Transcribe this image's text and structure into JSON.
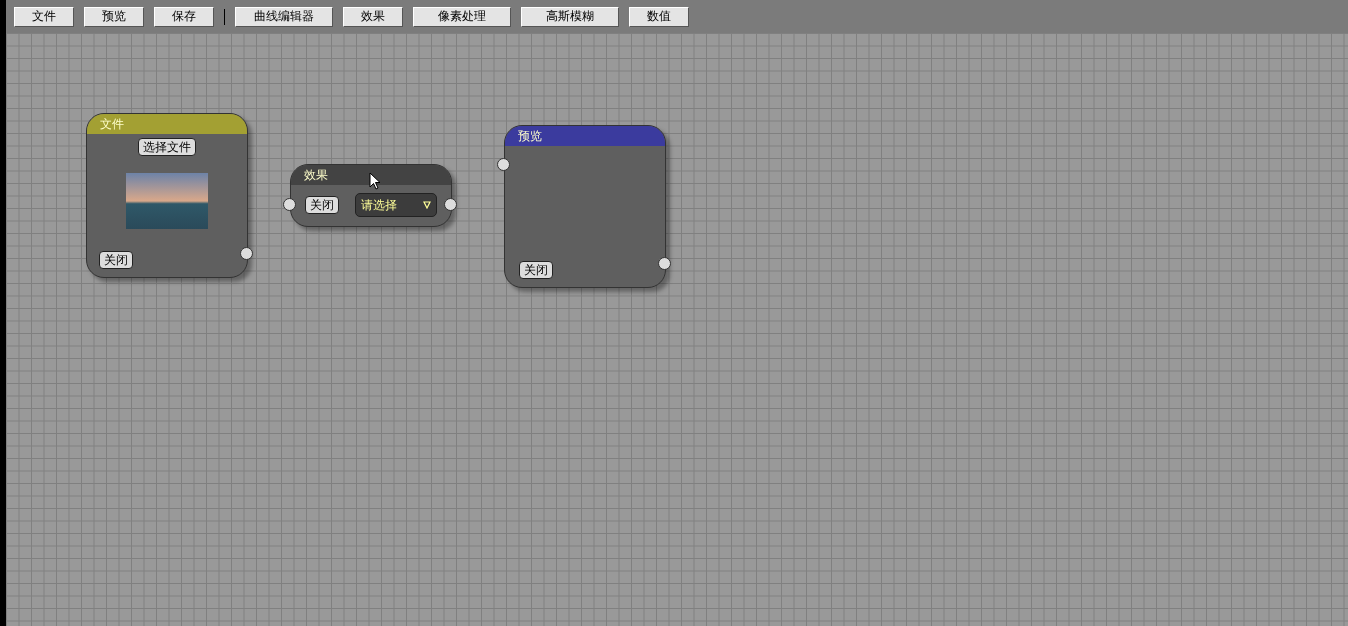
{
  "toolbar": [
    {
      "kind": "button",
      "label": "文件"
    },
    {
      "kind": "button",
      "label": "预览"
    },
    {
      "kind": "button",
      "label": "保存"
    },
    {
      "kind": "separator"
    },
    {
      "kind": "button",
      "label": "曲线编辑器"
    },
    {
      "kind": "button",
      "label": "效果"
    },
    {
      "kind": "button",
      "label": "像素处理"
    },
    {
      "kind": "button",
      "label": "高斯模糊"
    },
    {
      "kind": "button",
      "label": "数值"
    }
  ],
  "nodes": [
    {
      "kind": "file",
      "title": "文件",
      "color": "#a3a033",
      "select_button": "选择文件",
      "close_button": "关闭",
      "ports": [
        {
          "kind": "output"
        }
      ]
    },
    {
      "kind": "effect",
      "title": "效果",
      "color": "#434343",
      "dropdown": "请选择",
      "close_button": "关闭",
      "ports": [
        {
          "kind": "input"
        },
        {
          "kind": "output"
        }
      ]
    },
    {
      "kind": "preview",
      "title": "预览",
      "color": "#3b3b9e",
      "close_button": "关闭",
      "ports": [
        {
          "kind": "input"
        },
        {
          "kind": "output"
        }
      ]
    }
  ]
}
